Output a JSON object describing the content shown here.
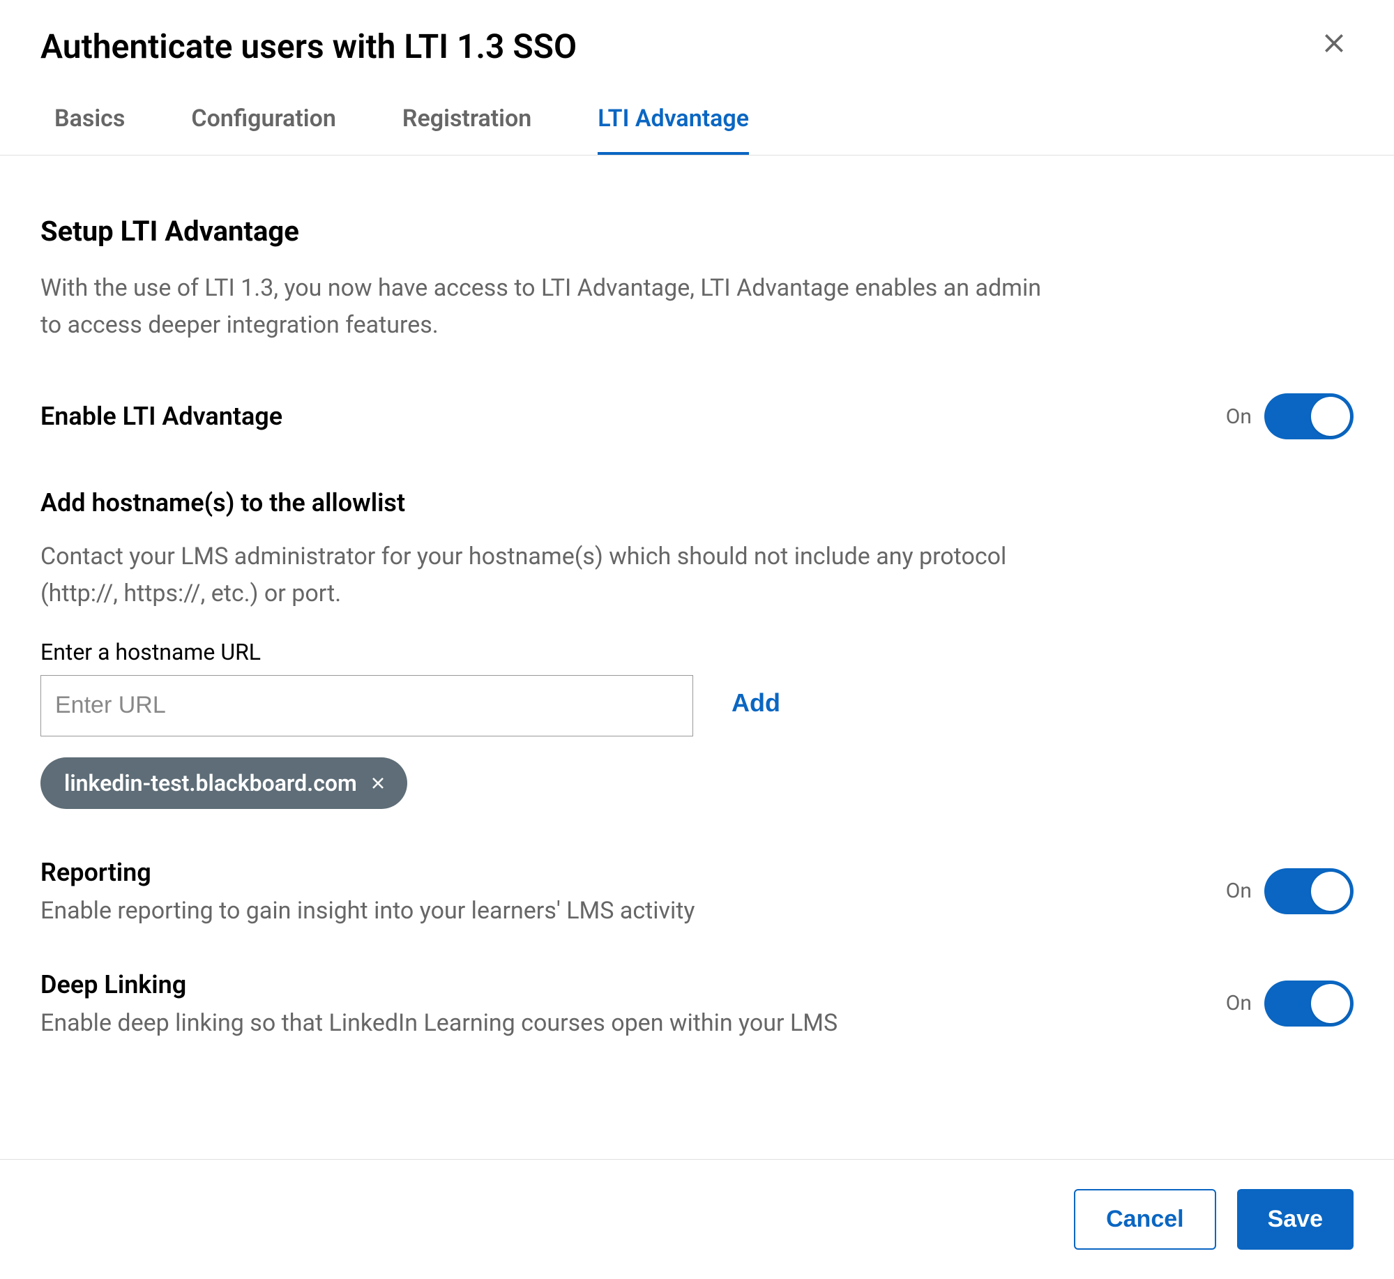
{
  "header": {
    "title": "Authenticate users with LTI 1.3 SSO"
  },
  "tabs": [
    {
      "label": "Basics",
      "active": false
    },
    {
      "label": "Configuration",
      "active": false
    },
    {
      "label": "Registration",
      "active": false
    },
    {
      "label": "LTI Advantage",
      "active": true
    }
  ],
  "section": {
    "title": "Setup LTI Advantage",
    "description": "With the use of LTI 1.3, you now have access to LTI Advantage, LTI Advantage enables an admin to access deeper integration features."
  },
  "enable_toggle": {
    "title": "Enable LTI Advantage",
    "state_text": "On"
  },
  "hostname": {
    "title": "Add hostname(s) to the allowlist",
    "description": "Contact your LMS administrator for your hostname(s) which should not include any protocol (http://, https://, etc.) or port.",
    "input_label": "Enter a hostname URL",
    "input_placeholder": "Enter URL",
    "add_label": "Add",
    "chips": [
      {
        "value": "linkedin-test.blackboard.com"
      }
    ]
  },
  "reporting": {
    "title": "Reporting",
    "description": "Enable reporting to gain insight into your learners' LMS activity",
    "state_text": "On"
  },
  "deep_linking": {
    "title": "Deep Linking",
    "description": "Enable deep linking so that LinkedIn Learning courses open within your LMS",
    "state_text": "On"
  },
  "footer": {
    "cancel_label": "Cancel",
    "save_label": "Save"
  }
}
